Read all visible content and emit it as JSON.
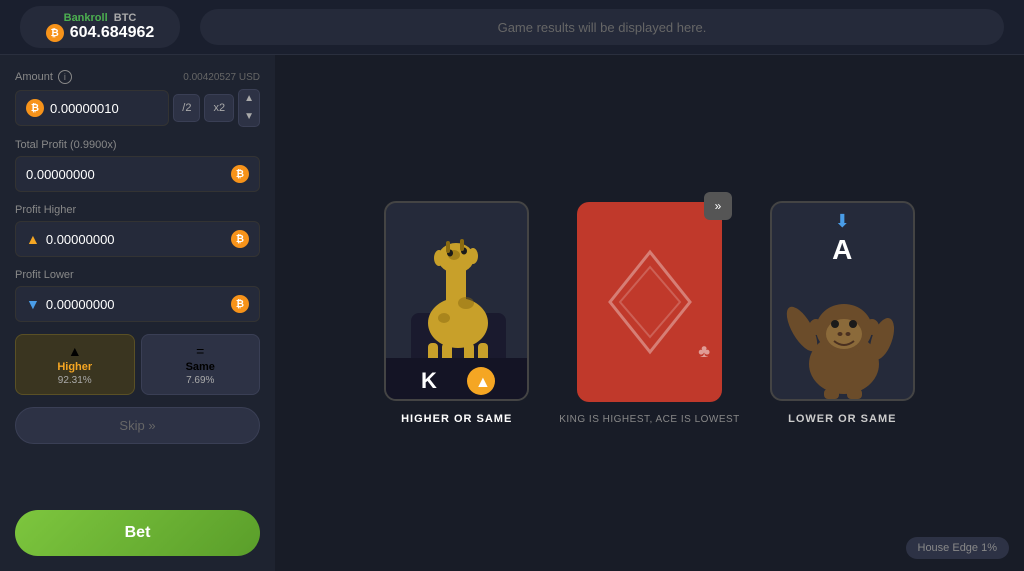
{
  "header": {
    "bankroll_label": "Bankroll",
    "bankroll_currency": "BTC",
    "bankroll_value": "604.684962",
    "results_placeholder": "Game results will be displayed here."
  },
  "left_panel": {
    "amount_label": "Amount",
    "amount_info": "i",
    "amount_usd": "0.00420527 USD",
    "amount_value": "0.00000010",
    "btn_half": "/2",
    "btn_double": "x2",
    "total_profit_label": "Total Profit (0.9900x)",
    "total_profit_value": "0.00000000",
    "profit_higher_label": "Profit Higher",
    "profit_higher_value": "0.00000000",
    "profit_lower_label": "Profit Lower",
    "profit_lower_value": "0.00000000",
    "higher_label": "Higher",
    "higher_pct": "92.31%",
    "same_label": "Same",
    "same_pct": "7.69%",
    "skip_label": "Skip",
    "skip_icon": "»",
    "bet_label": "Bet"
  },
  "game": {
    "left_card_label": "HIGHER OR SAME",
    "middle_card_description": "KING IS HIGHEST, ACE IS LOWEST",
    "right_card_label": "LOWER OR SAME",
    "card_hint": "»",
    "house_edge": "House Edge 1%"
  }
}
